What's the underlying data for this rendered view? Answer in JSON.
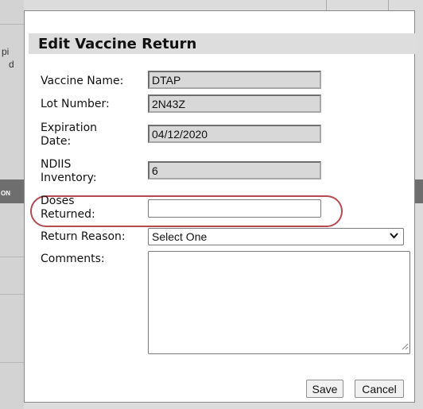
{
  "background": {
    "fragment_lines": [
      "pi",
      "d"
    ],
    "strip_text": "ON"
  },
  "dialog": {
    "title": "Edit Vaccine Return",
    "fields": {
      "vaccine_name": {
        "label": "Vaccine Name:",
        "value": "DTAP"
      },
      "lot_number": {
        "label": "Lot Number:",
        "value": "2N43Z"
      },
      "expiration_date": {
        "label_line1": "Expiration",
        "label_line2": "Date:",
        "value": "04/12/2020"
      },
      "ndiis_inventory": {
        "label_line1": "NDIIS",
        "label_line2": "Inventory:",
        "value": "6"
      },
      "doses_returned": {
        "label_line1": "Doses",
        "label_line2": "Returned:",
        "value": ""
      },
      "return_reason": {
        "label": "Return Reason:",
        "selected": "Select One"
      },
      "comments": {
        "label": "Comments:",
        "value": ""
      }
    },
    "buttons": {
      "save": "Save",
      "cancel": "Cancel"
    },
    "highlight_color": "#b54a52"
  }
}
